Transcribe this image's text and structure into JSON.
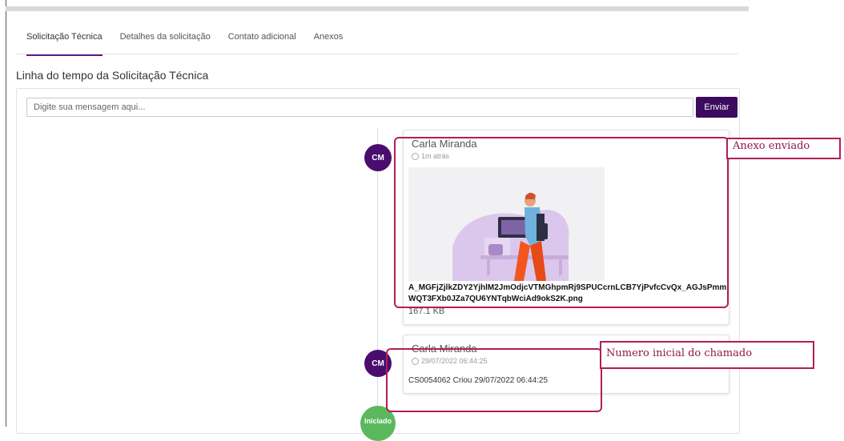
{
  "tabs": [
    {
      "label": "Solicitação Técnica"
    },
    {
      "label": "Detalhes da solicitação"
    },
    {
      "label": "Contato adicional"
    },
    {
      "label": "Anexos"
    }
  ],
  "timeline": {
    "heading": "Linha do tempo da Solicitação Técnica",
    "input_placeholder": "Digite sua mensagem aqui...",
    "send_label": "Enviar",
    "entries": [
      {
        "avatar": "CM",
        "author": "Carla Miranda",
        "time": "1m atrás",
        "attachment_filename": "A_MGFjZjlkZDY2YjhlM2JmOdjcVTMGhpmRj9SPUCcrnLCB7YjPvfcCvQx_AGJsPmmWQT3FXb0JZa7QU6YNTqbWciAd9okS2K.png",
        "attachment_size": "167.1 KB"
      },
      {
        "avatar": "CM",
        "author": "Carla Miranda",
        "time": "29/07/2022 06:44:25",
        "text": "CS0054062 Criou 29/07/2022 06:44:25"
      }
    ],
    "status": "Iniciado"
  },
  "annotations": {
    "attachment_label": "Anexo enviado",
    "initial_number_label": "Numero inicial do chamado"
  },
  "colors": {
    "accent": "#3d0b5e",
    "avatar": "#4a0d6e",
    "status_green": "#5cb85c",
    "annotation": "#b31d5a"
  },
  "icons": {
    "timestamp": "clock-icon"
  }
}
